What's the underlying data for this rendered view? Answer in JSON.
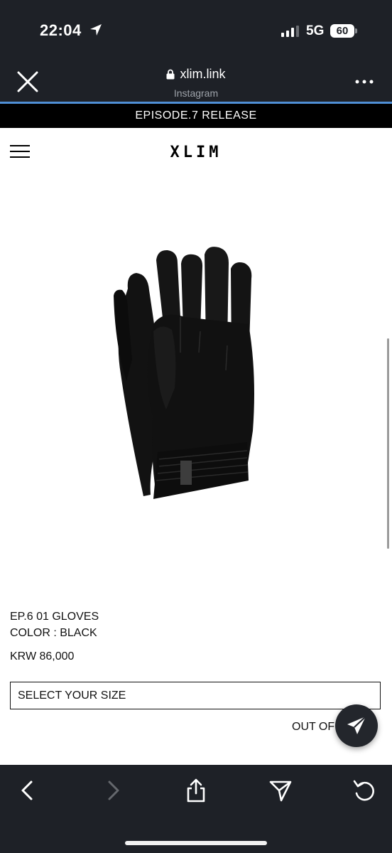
{
  "status_bar": {
    "time": "22:04",
    "network": "5G",
    "battery": "60"
  },
  "browser": {
    "url": "xlim.link",
    "source": "Instagram"
  },
  "site": {
    "announcement": "EPISODE.7 RELEASE",
    "logo": "XLIM"
  },
  "product": {
    "name": "EP.6 01 GLOVES",
    "color": "COLOR : BLACK",
    "price": "KRW 86,000",
    "size_select": "SELECT YOUR SIZE",
    "stock_status": "OUT OF STOCK"
  },
  "icons": {
    "close": "close-icon",
    "lock": "lock-icon",
    "more": "more-icon",
    "menu": "hamburger-icon",
    "share": "share-icon",
    "back": "chevron-left-icon",
    "forward": "chevron-right-icon",
    "upload": "upload-icon",
    "send": "send-icon",
    "reload": "reload-icon"
  },
  "colors": {
    "chrome_background": "#1e2127",
    "page_background": "#ffffff",
    "announcement_background": "#000000",
    "progress_accent": "#4f8fd6"
  }
}
